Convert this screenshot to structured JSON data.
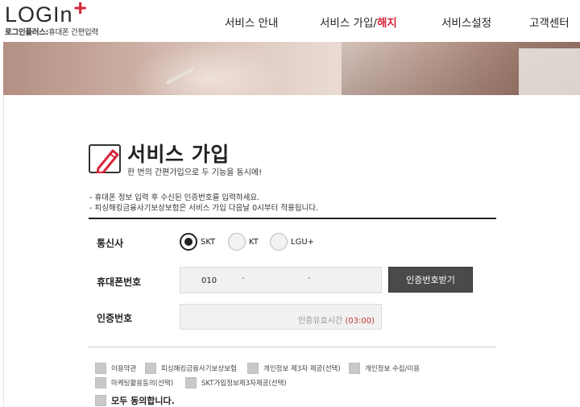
{
  "logo": {
    "wordmark": "LOGIn",
    "plus": "+",
    "sub_bold": "로그인플러스:",
    "sub_text": "휴대폰 간편입력"
  },
  "nav": {
    "items": [
      {
        "label": "서비스 안내"
      },
      {
        "label": "서비스 가입/",
        "accent": "해지"
      },
      {
        "label": "서비스설정"
      },
      {
        "label": "고객센터"
      }
    ]
  },
  "page": {
    "title": "서비스 가입",
    "subtitle": "한 번의 간편가입으로 두 기능을 동시에!",
    "notes": [
      "- 휴대폰 정보 입력 후 수신된 인증번호를 입력하세요.",
      "- 피싱해킹금융사기보상보험은 서비스 가입 다음날 0시부터 적용됩니다."
    ]
  },
  "form": {
    "carrier_label": "통신사",
    "carriers": [
      "SKT",
      "KT",
      "LGU+"
    ],
    "carrier_selected": "SKT",
    "phone_label": "휴대폰번호",
    "phone_prefix": "010",
    "phone_sep": "-",
    "code_button": "인증번호받기",
    "code_label": "인증번호",
    "code_hint": "인증유효시간",
    "code_time": "(03:00)"
  },
  "agreements": {
    "items": [
      "이용약관",
      "피싱해킹금융사기보상보험",
      "개인정보 제3자 제공(선택)",
      "개인정보 수집/이용",
      "마케팅활용동의(선택)",
      "SKT가입정보제3자제공(선택)"
    ],
    "all": "모두 동의합니다."
  }
}
